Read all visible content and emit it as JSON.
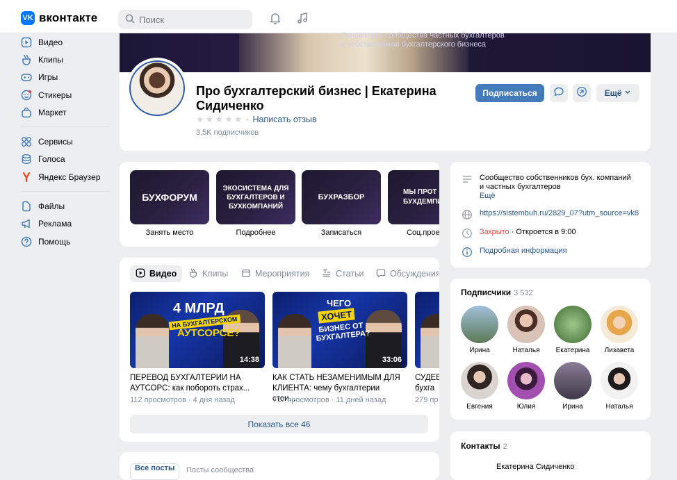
{
  "header": {
    "logo_text": "вконтакте",
    "logo_mark": "VK",
    "search_placeholder": "Поиск",
    "icons": [
      "bell-icon",
      "music-icon"
    ]
  },
  "sidebar": {
    "items": [
      {
        "label": "Видео",
        "icon": "video-icon"
      },
      {
        "label": "Клипы",
        "icon": "clips-icon"
      },
      {
        "label": "Игры",
        "icon": "gamepad-icon"
      },
      {
        "label": "Стикеры",
        "icon": "sticker-icon"
      },
      {
        "label": "Маркет",
        "icon": "bag-icon"
      },
      {
        "label": "Сервисы",
        "icon": "grid-icon"
      },
      {
        "label": "Голоса",
        "icon": "coins-icon"
      },
      {
        "label": "Яндекс Браузер",
        "icon": "yandex-icon"
      },
      {
        "label": "Файлы",
        "icon": "file-icon"
      },
      {
        "label": "Реклама",
        "icon": "megaphone-icon"
      },
      {
        "label": "Помощь",
        "icon": "help-icon"
      }
    ]
  },
  "cover": {
    "text_line1": "Основатель сообщества частных бухгалтеров",
    "text_line2": "и собственников бухгалтерского бизнеса"
  },
  "profile": {
    "title": "Про бухгалтерский бизнес | Екатерина Сидиченко",
    "review_link": "Написать отзыв",
    "rating_stars": 0,
    "subscribers": "3,5K подписчиков",
    "subscribe_button": "Подписаться",
    "more_button": "Ещё"
  },
  "links": [
    {
      "tile": "БУХФОРУМ",
      "caption": "Занять место"
    },
    {
      "tile": "ЭКОСИСТЕМА ДЛЯ БУХГАЛТЕРОВ И БУХКОМПАНИЙ",
      "caption": "Подробнее"
    },
    {
      "tile": "БУХРАЗБОР",
      "caption": "Записаться"
    },
    {
      "tile": "МЫ ПРОТ БУХДЕМПИ",
      "caption": "Соц.прое"
    }
  ],
  "info": {
    "description_line1": "Сообщество собственников бух. компаний",
    "description_line2": "и частных бухгалтеров",
    "more": "Ещё",
    "url": "https://sistembuh.ru/2829_07?utm_source=vk8",
    "status_closed": "Закрыто",
    "status_opens": "· Откроется в 9:00",
    "details_link": "Подробная информация"
  },
  "videos": {
    "tabs": [
      {
        "label": "Видео",
        "icon": "video-icon"
      },
      {
        "label": "Клипы",
        "icon": "clips-icon"
      },
      {
        "label": "Мероприятия",
        "icon": "calendar-icon"
      },
      {
        "label": "Статьи",
        "icon": "article-icon"
      },
      {
        "label": "Обсуждения",
        "icon": "chat-icon"
      }
    ],
    "items": [
      {
        "thumb_big": "4 МЛРД",
        "thumb_tag": "НА БУХГАЛТЕРСКОМ",
        "thumb_sub": "АУТСОРСЕ?",
        "duration": "14:38",
        "title": "ПЕРЕВОД БУХГАЛТЕРИИ НА АУТСОРС: как побороть страх...",
        "meta": "112 просмотров · 4 дня назад"
      },
      {
        "thumb_big": "ЧЕГО",
        "thumb_tag": "ХОЧЕТ",
        "thumb_sub": "БИЗНЕС ОТ БУХГАЛТЕРА?",
        "duration": "33:06",
        "title": "КАК СТАТЬ НЕЗАМЕНИМЫМ ДЛЯ КЛИЕНТА: чему бухгалтерии стои...",
        "meta": "717 просмотров · 11 дней назад"
      },
      {
        "thumb_big": "",
        "thumb_tag": "",
        "thumb_sub": "",
        "duration": "",
        "title": "СУДЕБ бухга",
        "meta": "279 пр"
      }
    ],
    "show_all": "Показать все 46"
  },
  "members": {
    "heading": "Подписчики",
    "count": "3 532",
    "people": [
      {
        "name": "Ирина",
        "color": "#7ea6c4"
      },
      {
        "name": "Наталья",
        "color": "#c9a79a"
      },
      {
        "name": "Екатерина",
        "color": "#5f8f4e"
      },
      {
        "name": "Лизавета",
        "color": "#e8a64a"
      },
      {
        "name": "Евгения",
        "color": "#6b5a55"
      },
      {
        "name": "Юлия",
        "color": "#8a3f8f"
      },
      {
        "name": "Ирина",
        "color": "#5d5566"
      },
      {
        "name": "Наталья",
        "color": "#3e3a3c"
      }
    ]
  },
  "contacts": {
    "heading": "Контакты",
    "count": "2",
    "first_name": "Екатерина Сидиченко"
  },
  "posts": {
    "tab_all": "Все посты",
    "tab_community": "Посты сообщества"
  },
  "colors": {
    "accent": "#447bba",
    "link": "#2a5885",
    "closed": "#e64646",
    "muted": "#818c99"
  }
}
